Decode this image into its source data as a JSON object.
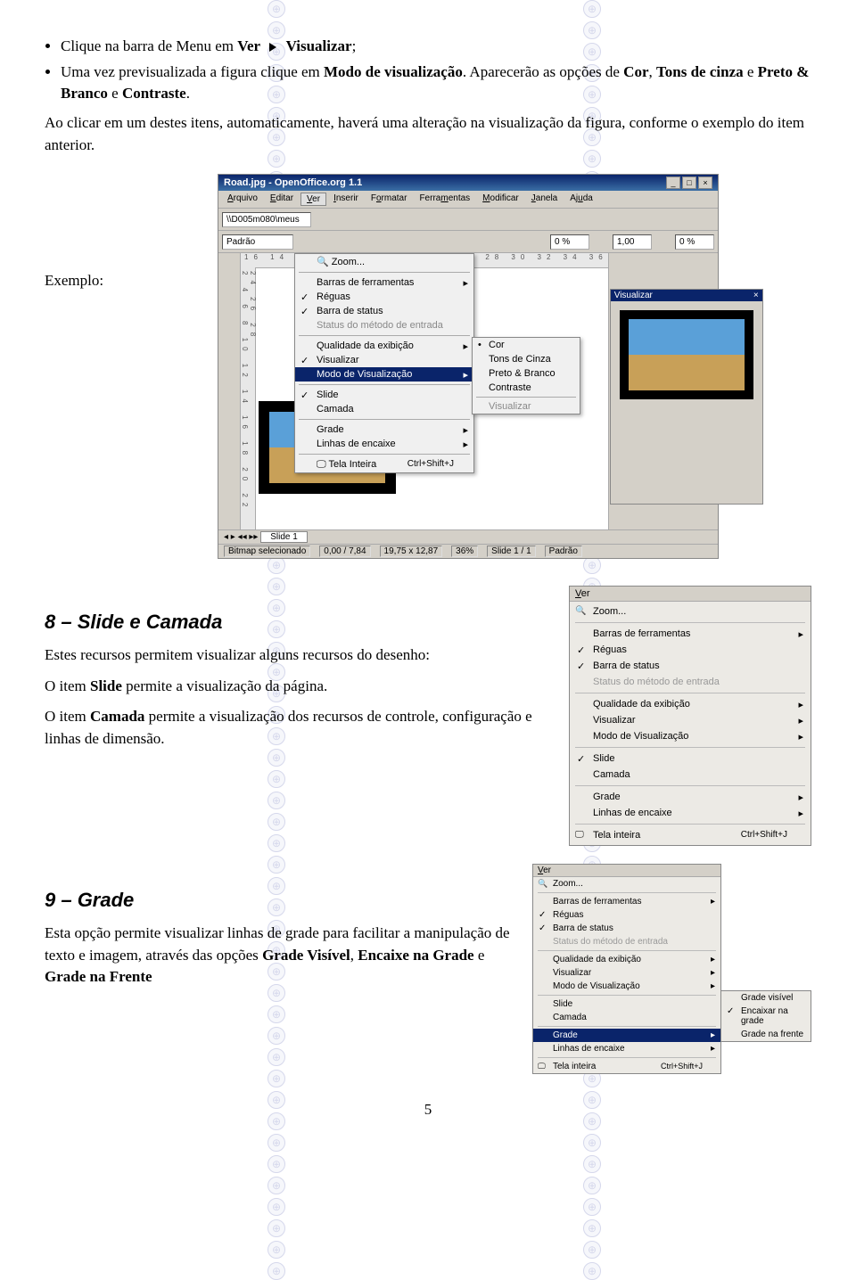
{
  "bullets": {
    "b1_pre": "Clique na barra de Menu em ",
    "b1_ver": "Ver",
    "b1_vis": "Visualizar",
    "b1_semi": ";",
    "b2_a": "Uma vez previsualizada a figura clique em ",
    "b2_modo": "Modo de visualização",
    "b2_b": ". Aparecerão as opções de ",
    "b2_cor": "Cor",
    "b2_comma": ", ",
    "b2_tons": "Tons de cinza",
    "b2_e": " e ",
    "b2_pb": "Preto & Branco",
    "b2_e2": " e ",
    "b2_cont": "Contraste",
    "b2_dot": "."
  },
  "para1": "Ao clicar em um destes itens, automaticamente, haverá uma alteração na visualização da figura, conforme o exemplo do item anterior.",
  "exemplo": "Exemplo:",
  "sshot1": {
    "title": "Road.jpg - OpenOffice.org 1.1",
    "menus": [
      "Arquivo",
      "Editar",
      "Ver",
      "Inserir",
      "Formatar",
      "Ferramentas",
      "Modificar",
      "Janela",
      "Ajuda"
    ],
    "path_input": "\\\\D005m080\\meus",
    "style_input": "Padrão",
    "ruler_h": "16  14  1   4  16  18  20  22  24  26  28  30  32  34  36",
    "ruler_v": "2 4 6 8 10 12 14 16 18 20 22 24 26 28",
    "dropdown": {
      "zoom": "Zoom...",
      "barras": "Barras de ferramentas",
      "reguas": "Réguas",
      "barra_status": "Barra de status",
      "status_metodo": "Status do método de entrada",
      "qualidade": "Qualidade da exibição",
      "visualizar": "Visualizar",
      "modo_vis": "Modo de Visualização",
      "slide": "Slide",
      "camada": "Camada",
      "grade": "Grade",
      "linhas": "Linhas de encaixe",
      "tela": "Tela Inteira",
      "tela_kbd": "Ctrl+Shift+J"
    },
    "submenu": {
      "cor": "Cor",
      "tons": "Tons de Cinza",
      "pb": "Preto & Branco",
      "contraste": "Contraste",
      "visualizar": "Visualizar"
    },
    "preview_hdr": "Visualizar",
    "tab": "Slide 1",
    "status": {
      "sel": "Bitmap selecionado",
      "coord": "0,00 / 7,84",
      "size": "19,75 x 12,87",
      "zoom": "36%",
      "slide": "Slide 1 / 1",
      "mode": "Padrão"
    },
    "tb2_vals": [
      "0 %",
      "1,00",
      "0 %"
    ]
  },
  "sec8": {
    "title": "8 – Slide e Camada",
    "p1": "Estes recursos permitem visualizar alguns recursos do desenho:",
    "p2a": "O item ",
    "p2b": "Slide",
    "p2c": " permite a visualização da página.",
    "p3a": "O item ",
    "p3b": "Camada",
    "p3c": " permite a visualização dos recursos de controle, configuração e linhas de dimensão."
  },
  "sshot2": {
    "hdr": "Ver",
    "zoom": "Zoom...",
    "barras": "Barras de ferramentas",
    "reguas": "Réguas",
    "barra_status": "Barra de status",
    "status_metodo": "Status do método de entrada",
    "qualidade": "Qualidade da exibição",
    "visualizar": "Visualizar",
    "modo": "Modo de Visualização",
    "slide": "Slide",
    "camada": "Camada",
    "grade": "Grade",
    "linhas": "Linhas de encaixe",
    "tela": "Tela inteira",
    "tela_kbd": "Ctrl+Shift+J"
  },
  "sec9": {
    "title": "9 – Grade",
    "p1a": "Esta opção permite visualizar linhas de grade para facilitar a manipulação de texto e imagem, através das opções ",
    "p1b": "Grade Visível",
    "p1c": ", ",
    "p1d": "Encaixe na Grade",
    "p1e": " e ",
    "p1f": "Grade na Frente"
  },
  "sshot3": {
    "hdr": "Ver",
    "zoom": "Zoom...",
    "barras": "Barras de ferramentas",
    "reguas": "Réguas",
    "barra_status": "Barra de status",
    "status_metodo": "Status do método de entrada",
    "qualidade": "Qualidade da exibição",
    "visualizar": "Visualizar",
    "modo": "Modo de Visualização",
    "slide": "Slide",
    "camada": "Camada",
    "grade": "Grade",
    "linhas": "Linhas de encaixe",
    "tela": "Tela inteira",
    "tela_kbd": "Ctrl+Shift+J",
    "sub_vis": "Grade visível",
    "sub_enc": "Encaixar na grade",
    "sub_frente": "Grade na frente"
  },
  "pagenum": "5"
}
